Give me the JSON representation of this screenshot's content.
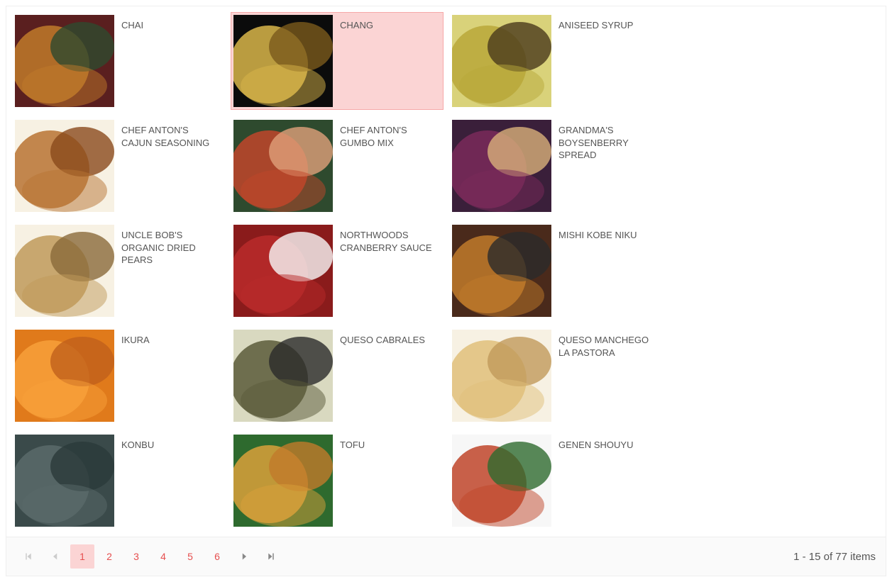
{
  "colors": {
    "selected_bg": "#fbd4d4",
    "selected_border": "#f6a9a9",
    "page_accent": "#e64f4f"
  },
  "items": [
    {
      "label": "CHAI",
      "selected": false,
      "img": "chai"
    },
    {
      "label": "CHANG",
      "selected": true,
      "img": "chang"
    },
    {
      "label": "ANISEED SYRUP",
      "selected": false,
      "img": "aniseed"
    },
    {
      "label": "CHEF ANTON'S CAJUN SEASONING",
      "selected": false,
      "img": "cajun"
    },
    {
      "label": "CHEF ANTON'S GUMBO MIX",
      "selected": false,
      "img": "gumbo"
    },
    {
      "label": "GRANDMA'S BOYSENBERRY SPREAD",
      "selected": false,
      "img": "boysen"
    },
    {
      "label": "UNCLE BOB'S ORGANIC DRIED PEARS",
      "selected": false,
      "img": "pears"
    },
    {
      "label": "NORTHWOODS CRANBERRY SAUCE",
      "selected": false,
      "img": "cranberry"
    },
    {
      "label": "MISHI KOBE NIKU",
      "selected": false,
      "img": "kobe"
    },
    {
      "label": "IKURA",
      "selected": false,
      "img": "ikura"
    },
    {
      "label": "QUESO CABRALES",
      "selected": false,
      "img": "cabrales"
    },
    {
      "label": "QUESO MANCHEGO LA PASTORA",
      "selected": false,
      "img": "manchego"
    },
    {
      "label": "KONBU",
      "selected": false,
      "img": "konbu"
    },
    {
      "label": "TOFU",
      "selected": false,
      "img": "tofu"
    },
    {
      "label": "GENEN SHOUYU",
      "selected": false,
      "img": "shouyu"
    }
  ],
  "pager": {
    "pages": [
      "1",
      "2",
      "3",
      "4",
      "5",
      "6"
    ],
    "current": "1",
    "info": "1 - 15 of 77 items",
    "first_disabled": true,
    "prev_disabled": true,
    "next_disabled": false,
    "last_disabled": false
  },
  "thumbs": {
    "chai": {
      "c1": "#5a1f1f",
      "c2": "#c07a2a",
      "c3": "#2e4a2e"
    },
    "chang": {
      "c1": "#0b0b0b",
      "c2": "#d9b64a",
      "c3": "#7a5a1b"
    },
    "aniseed": {
      "c1": "#d9d27a",
      "c2": "#b8a83a",
      "c3": "#4a3a1b"
    },
    "cajun": {
      "c1": "#f7f1e3",
      "c2": "#b87333",
      "c3": "#8a4a1b"
    },
    "gumbo": {
      "c1": "#2e4a2e",
      "c2": "#c0452a",
      "c3": "#e0a07a"
    },
    "boysen": {
      "c1": "#3a1f3a",
      "c2": "#7a2a5a",
      "c3": "#d9b07a"
    },
    "pears": {
      "c1": "#f7f1e3",
      "c2": "#c09a5a",
      "c3": "#8a6a3a"
    },
    "cranberry": {
      "c1": "#8a1b1b",
      "c2": "#b82a2a",
      "c3": "#f7f7f7"
    },
    "kobe": {
      "c1": "#4a2a1b",
      "c2": "#c07a2a",
      "c3": "#2a2a2a"
    },
    "ikura": {
      "c1": "#e07a1b",
      "c2": "#f7a03a",
      "c3": "#c0601b"
    },
    "cabrales": {
      "c1": "#d9d9c0",
      "c2": "#5a5a3a",
      "c3": "#2a2a2a"
    },
    "manchego": {
      "c1": "#f7f1e3",
      "c2": "#e0c07a",
      "c3": "#c09a5a"
    },
    "konbu": {
      "c1": "#3a4a4a",
      "c2": "#5a6a6a",
      "c3": "#2a3a3a"
    },
    "tofu": {
      "c1": "#2e6a2e",
      "c2": "#d9a03a",
      "c3": "#c07a2a"
    },
    "shouyu": {
      "c1": "#f7f7f7",
      "c2": "#c0452a",
      "c3": "#2e6a2e"
    }
  }
}
